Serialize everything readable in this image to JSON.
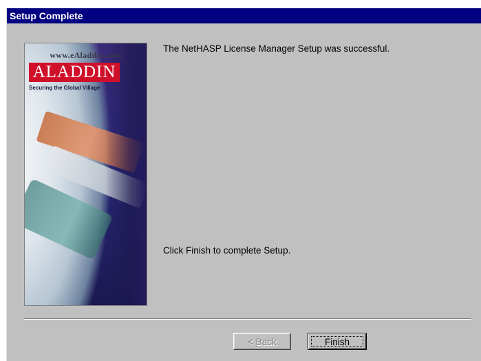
{
  "window": {
    "title": "Setup Complete"
  },
  "banner": {
    "url_text": "www.eAladdin.com",
    "brand": "ALADDIN",
    "tagline": "Securing the Global Village"
  },
  "messages": {
    "success": "The NetHASP License Manager Setup was successful.",
    "instruction": "Click Finish to complete Setup."
  },
  "buttons": {
    "back_prefix": "< ",
    "back_mnemonic": "B",
    "back_rest": "ack",
    "finish": "Finish"
  },
  "colors": {
    "titlebar": "#000080",
    "dialog_face": "#c0c0c0",
    "brand_red": "#d0102a"
  }
}
